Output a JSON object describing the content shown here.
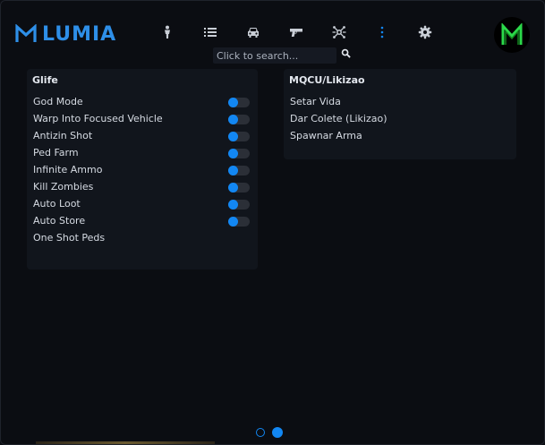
{
  "brand": {
    "name": "LUMIA",
    "color": "#2e8fe8"
  },
  "nav": [
    {
      "icon": "person-icon",
      "active": false
    },
    {
      "icon": "list-icon",
      "active": false
    },
    {
      "icon": "car-icon",
      "active": false
    },
    {
      "icon": "gun-icon",
      "active": false
    },
    {
      "icon": "network-icon",
      "active": false
    },
    {
      "icon": "more-vertical-icon",
      "active": true
    },
    {
      "icon": "gear-icon",
      "active": false
    }
  ],
  "search": {
    "placeholder": "Click to search..."
  },
  "left_panel": {
    "title": "Glife",
    "items": [
      {
        "label": "God Mode",
        "toggle": true
      },
      {
        "label": "Warp Into Focused Vehicle",
        "toggle": true
      },
      {
        "label": "Antizin Shot",
        "toggle": true
      },
      {
        "label": "Ped Farm",
        "toggle": true
      },
      {
        "label": "Infinite Ammo",
        "toggle": true
      },
      {
        "label": "Kill Zombies",
        "toggle": true
      },
      {
        "label": "Auto Loot",
        "toggle": true
      },
      {
        "label": "Auto Store",
        "toggle": true
      },
      {
        "label": "One Shot Peds",
        "toggle": false
      }
    ]
  },
  "right_panel": {
    "title": "MQCU/Likizao",
    "items": [
      {
        "label": "Setar Vida"
      },
      {
        "label": "Dar Colete (Likizao)"
      },
      {
        "label": "Spawnar Arma"
      }
    ]
  },
  "pagination": {
    "pages": 2,
    "current": 2
  },
  "colors": {
    "accent": "#1287f3",
    "panel": "#11151c",
    "background": "#0b0d12"
  }
}
